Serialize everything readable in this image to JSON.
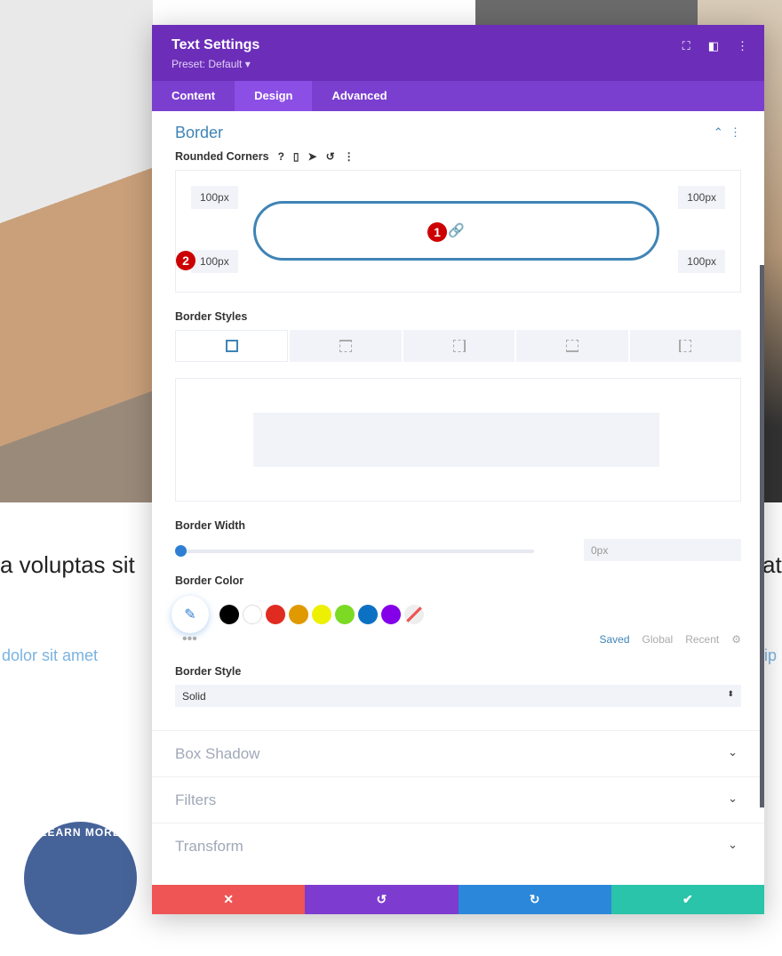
{
  "background": {
    "text_left": "a voluptas sit",
    "text_right": "ate",
    "link_left": "dolor sit amet",
    "link_right": "ip",
    "button": "LEARN MORE"
  },
  "modal": {
    "title": "Text Settings",
    "preset": "Preset: Default ▾",
    "tabs": [
      {
        "label": "Content"
      },
      {
        "label": "Design"
      },
      {
        "label": "Advanced"
      }
    ],
    "border": {
      "title": "Border",
      "rounded_label": "Rounded Corners",
      "corners": {
        "top_left": "100px",
        "top_right": "100px",
        "bottom_left": "100px",
        "bottom_right": "100px"
      },
      "badges": [
        "1",
        "2"
      ],
      "styles_label": "Border Styles",
      "width_label": "Border Width",
      "width_value": "0px",
      "color_label": "Border Color",
      "swatches": [
        "#000000",
        "#ffffff",
        "#e02b20",
        "#e09900",
        "#edf000",
        "#7cda24",
        "#0c71c3",
        "#8300e9"
      ],
      "color_tabs": [
        "Saved",
        "Global",
        "Recent"
      ],
      "style_label": "Border Style",
      "style_value": "Solid"
    },
    "sections": [
      "Box Shadow",
      "Filters",
      "Transform"
    ]
  },
  "colors": {
    "header": "#6c2eb9",
    "accent": "#3f84b6",
    "cancel": "#ef5555",
    "undo": "#7d3bcf",
    "redo": "#2b87da",
    "save": "#29c4a9"
  }
}
